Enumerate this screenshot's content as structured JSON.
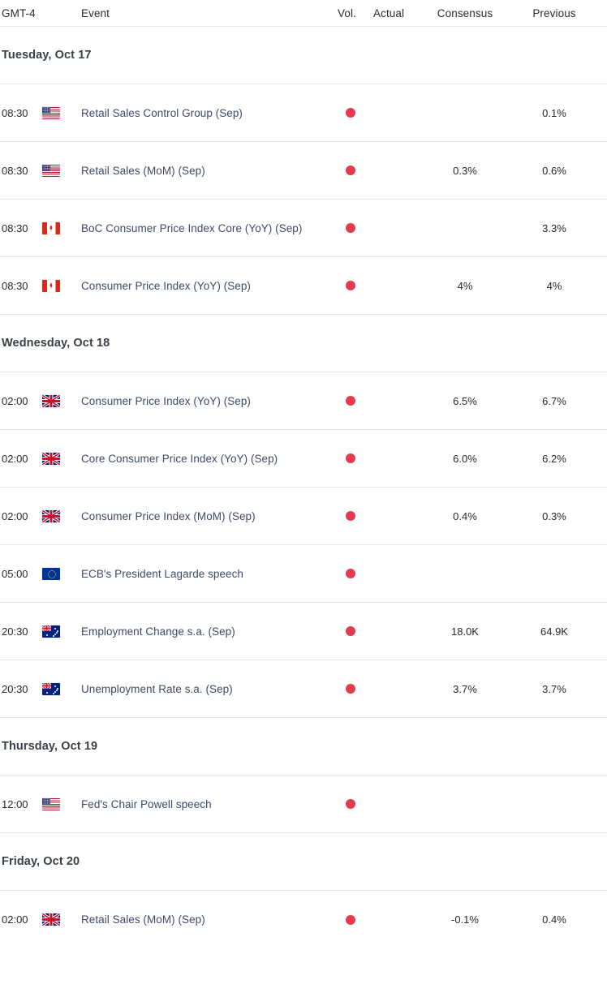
{
  "header": {
    "timezone_label": "GMT-4",
    "event_label": "Event",
    "vol_label": "Vol.",
    "actual_label": "Actual",
    "consensus_label": "Consensus",
    "previous_label": "Previous"
  },
  "colors": {
    "volatility_high": "#e23b4e",
    "event_link": "#3c4a6b",
    "row_border": "#e3e6e8",
    "date_heading": "#3a4047",
    "value_text": "#24292e"
  },
  "groups": [
    {
      "date": "Tuesday, Oct 17",
      "rows": [
        {
          "time": "08:30",
          "country": "us",
          "country_name": "United States",
          "event": "Retail Sales Control Group (Sep)",
          "volatility": "high",
          "actual": "",
          "consensus": "",
          "previous": "0.1%"
        },
        {
          "time": "08:30",
          "country": "us",
          "country_name": "United States",
          "event": "Retail Sales (MoM) (Sep)",
          "volatility": "high",
          "actual": "",
          "consensus": "0.3%",
          "previous": "0.6%"
        },
        {
          "time": "08:30",
          "country": "ca",
          "country_name": "Canada",
          "event": "BoC Consumer Price Index Core (YoY) (Sep)",
          "volatility": "high",
          "actual": "",
          "consensus": "",
          "previous": "3.3%"
        },
        {
          "time": "08:30",
          "country": "ca",
          "country_name": "Canada",
          "event": "Consumer Price Index (YoY) (Sep)",
          "volatility": "high",
          "actual": "",
          "consensus": "4%",
          "previous": "4%"
        }
      ]
    },
    {
      "date": "Wednesday, Oct 18",
      "rows": [
        {
          "time": "02:00",
          "country": "gb",
          "country_name": "United Kingdom",
          "event": "Consumer Price Index (YoY) (Sep)",
          "volatility": "high",
          "actual": "",
          "consensus": "6.5%",
          "previous": "6.7%"
        },
        {
          "time": "02:00",
          "country": "gb",
          "country_name": "United Kingdom",
          "event": "Core Consumer Price Index (YoY) (Sep)",
          "volatility": "high",
          "actual": "",
          "consensus": "6.0%",
          "previous": "6.2%"
        },
        {
          "time": "02:00",
          "country": "gb",
          "country_name": "United Kingdom",
          "event": "Consumer Price Index (MoM) (Sep)",
          "volatility": "high",
          "actual": "",
          "consensus": "0.4%",
          "previous": "0.3%"
        },
        {
          "time": "05:00",
          "country": "eu",
          "country_name": "European Union",
          "event": "ECB's President Lagarde speech",
          "volatility": "high",
          "actual": "",
          "consensus": "",
          "previous": ""
        },
        {
          "time": "20:30",
          "country": "au",
          "country_name": "Australia",
          "event": "Employment Change s.a. (Sep)",
          "volatility": "high",
          "actual": "",
          "consensus": "18.0K",
          "previous": "64.9K"
        },
        {
          "time": "20:30",
          "country": "au",
          "country_name": "Australia",
          "event": "Unemployment Rate s.a. (Sep)",
          "volatility": "high",
          "actual": "",
          "consensus": "3.7%",
          "previous": "3.7%"
        }
      ]
    },
    {
      "date": "Thursday, Oct 19",
      "rows": [
        {
          "time": "12:00",
          "country": "us",
          "country_name": "United States",
          "event": "Fed's Chair Powell speech",
          "volatility": "high",
          "actual": "",
          "consensus": "",
          "previous": ""
        }
      ]
    },
    {
      "date": "Friday, Oct 20",
      "rows": [
        {
          "time": "02:00",
          "country": "gb",
          "country_name": "United Kingdom",
          "event": "Retail Sales (MoM) (Sep)",
          "volatility": "high",
          "actual": "",
          "consensus": "-0.1%",
          "previous": "0.4%"
        }
      ]
    }
  ]
}
